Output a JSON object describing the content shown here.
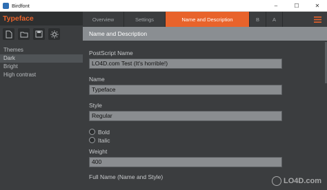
{
  "window": {
    "title": "Birdfont",
    "minimize": "–",
    "maximize": "☐",
    "close": "✕"
  },
  "sidebar": {
    "app_title": "Typeface",
    "tools": [
      "new-file-icon",
      "open-folder-icon",
      "save-icon",
      "settings-gear-icon"
    ],
    "heading": "Themes",
    "items": [
      {
        "label": "Dark",
        "selected": true
      },
      {
        "label": "Bright",
        "selected": false
      },
      {
        "label": "High contrast",
        "selected": false
      }
    ]
  },
  "tabs": [
    {
      "label": "Overview",
      "active": false
    },
    {
      "label": "Settings",
      "active": false
    },
    {
      "label": "Name and Description",
      "active": true
    },
    {
      "label": "B",
      "active": false
    },
    {
      "label": "A",
      "active": false
    }
  ],
  "content": {
    "section_title": "Name and Description",
    "postscript_label": "PostScript Name",
    "postscript_value": "LO4D.com Test (It's horrible!)",
    "name_label": "Name",
    "name_value": "Typeface",
    "style_label": "Style",
    "style_value": "Regular",
    "bold_label": "Bold",
    "italic_label": "Italic",
    "weight_label": "Weight",
    "weight_value": "400",
    "fullname_label": "Full Name (Name and Style)"
  },
  "watermark": {
    "text": "LO4D.com"
  },
  "colors": {
    "accent": "#e8632b",
    "background": "#3b3d3f",
    "input_bg": "#8a8d90"
  }
}
